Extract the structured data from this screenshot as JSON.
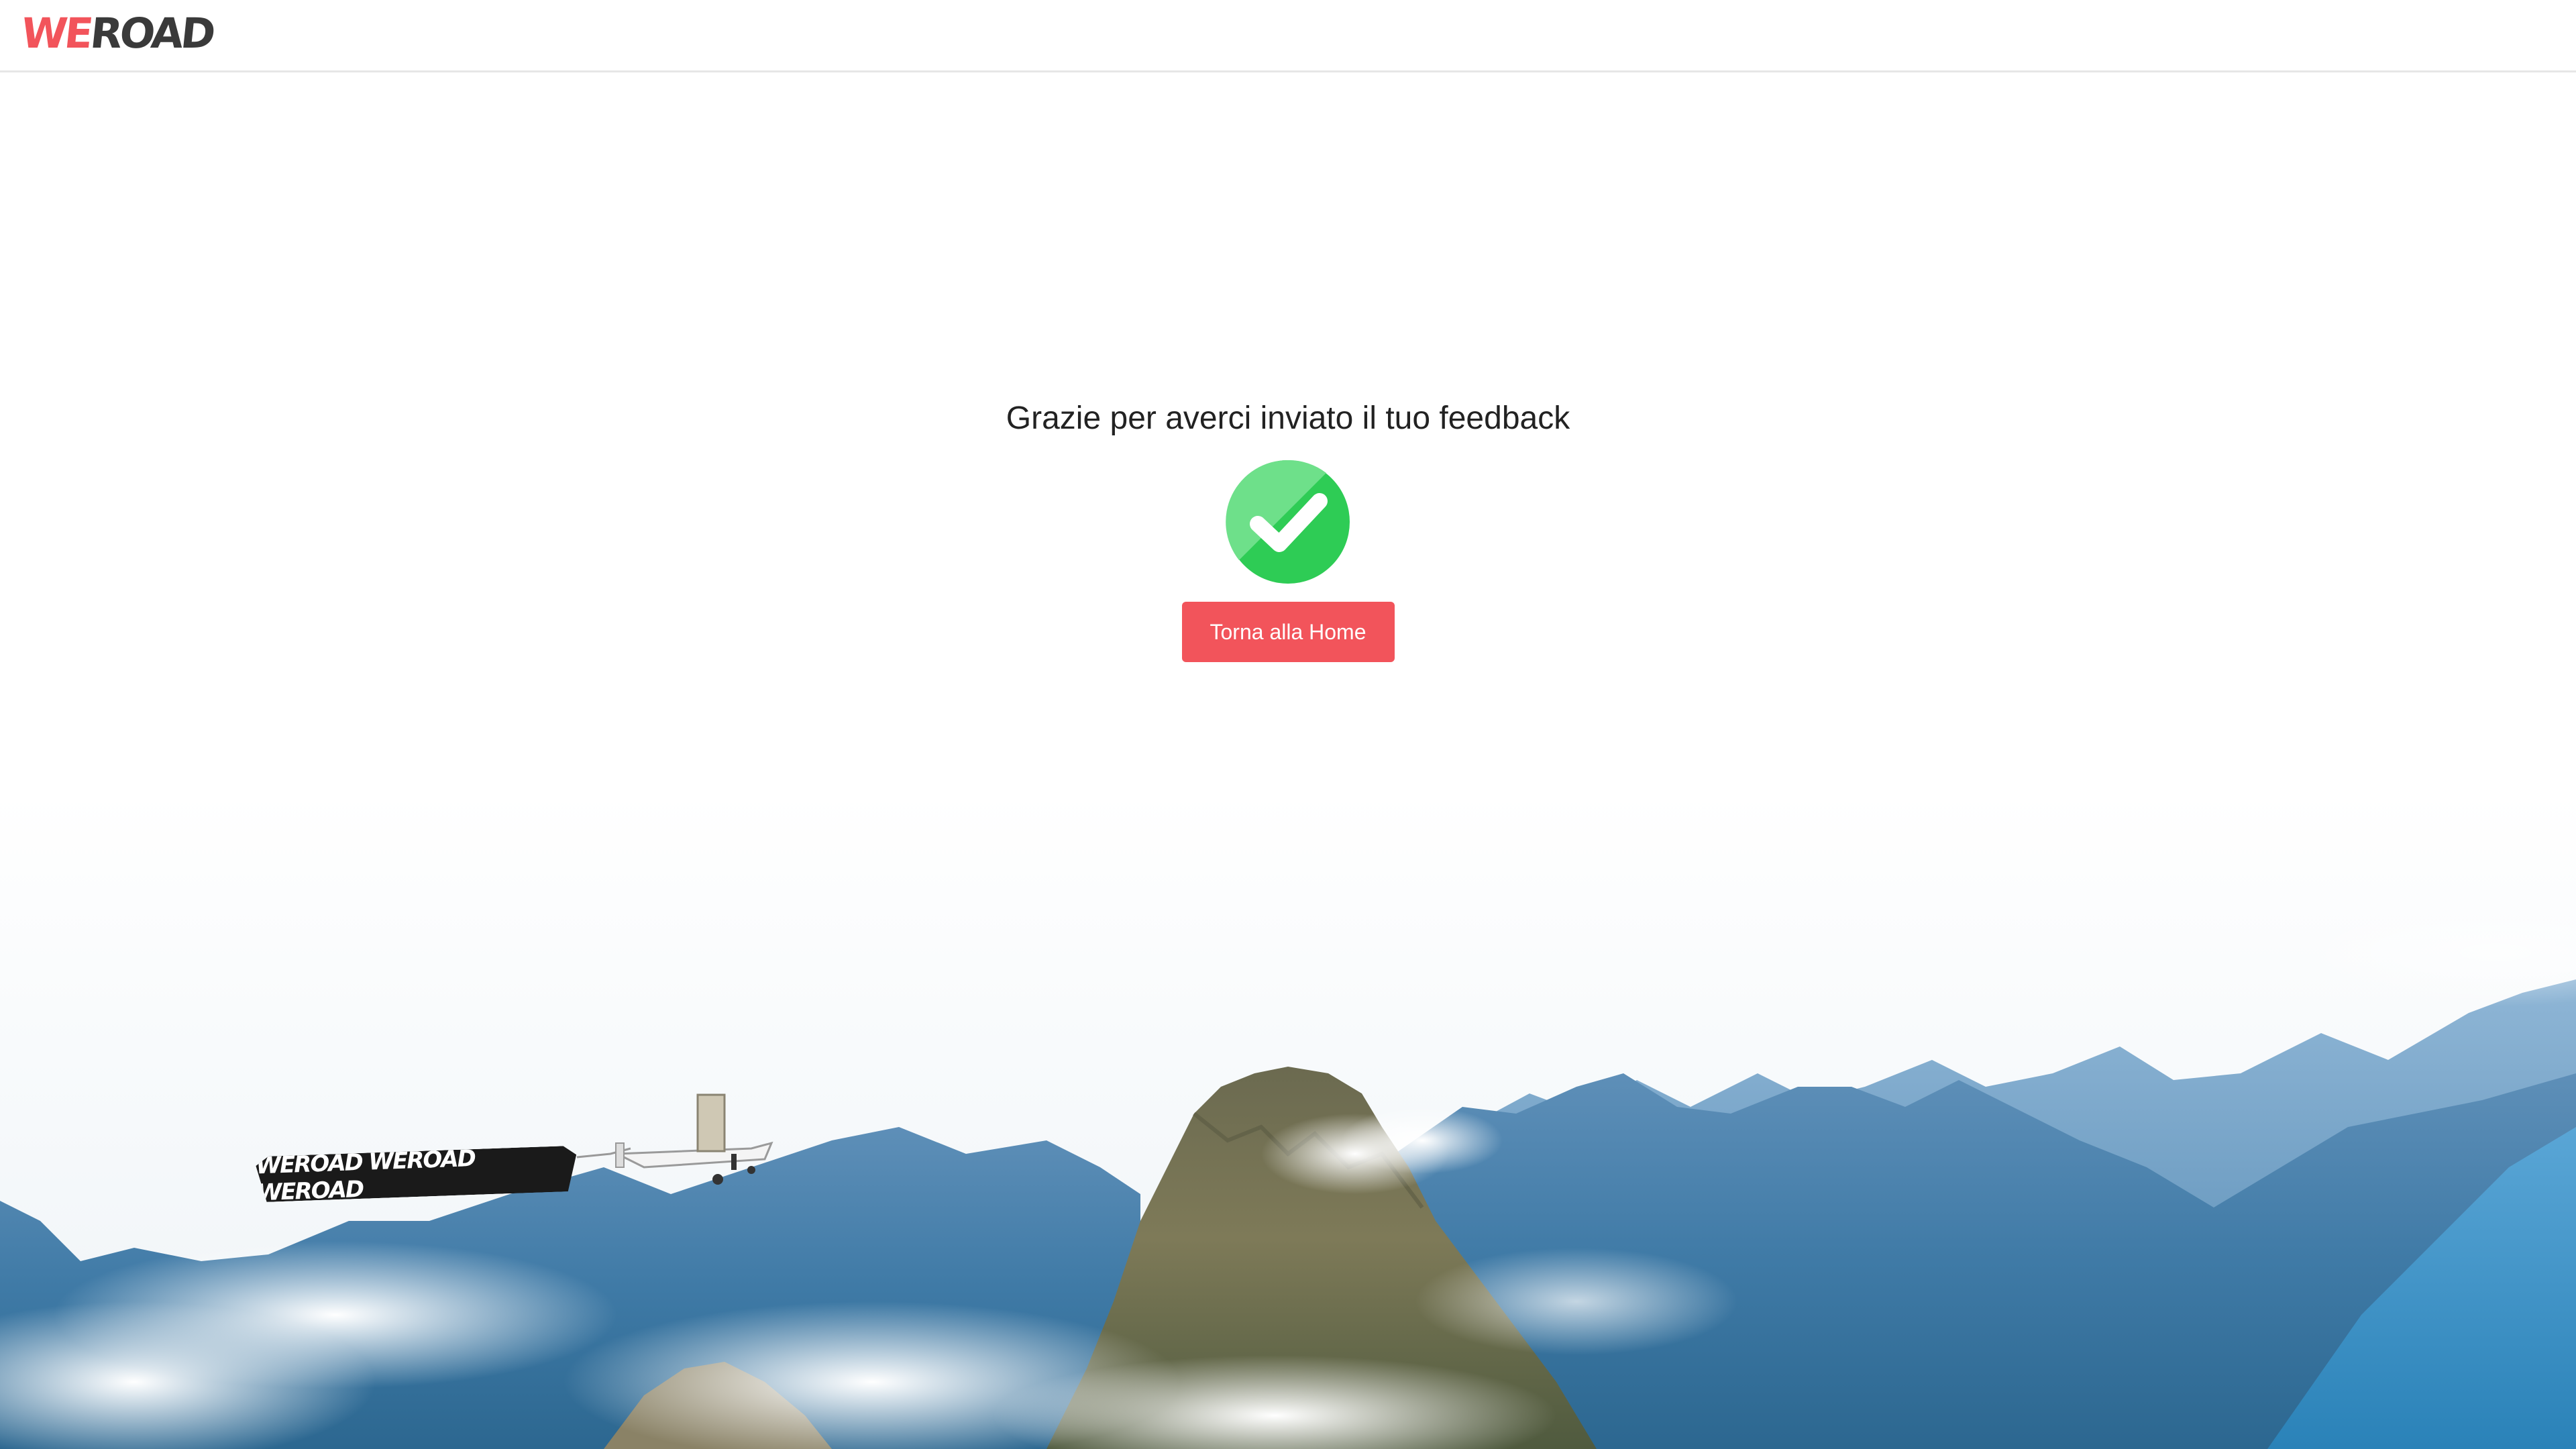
{
  "header": {
    "logo_we": "WE",
    "logo_road": "ROAD"
  },
  "main": {
    "title": "Grazie per averci inviato il tuo feedback",
    "home_button_label": "Torna alla Home",
    "status_icon": "checkmark-circle-icon"
  },
  "banner": {
    "text": "WEROAD WEROAD WEROAD",
    "we": "WE",
    "road": "ROAD"
  },
  "colors": {
    "brand_red": "#f2545b",
    "success_green": "#2ecc55",
    "logo_dark": "#3a3a3a"
  }
}
